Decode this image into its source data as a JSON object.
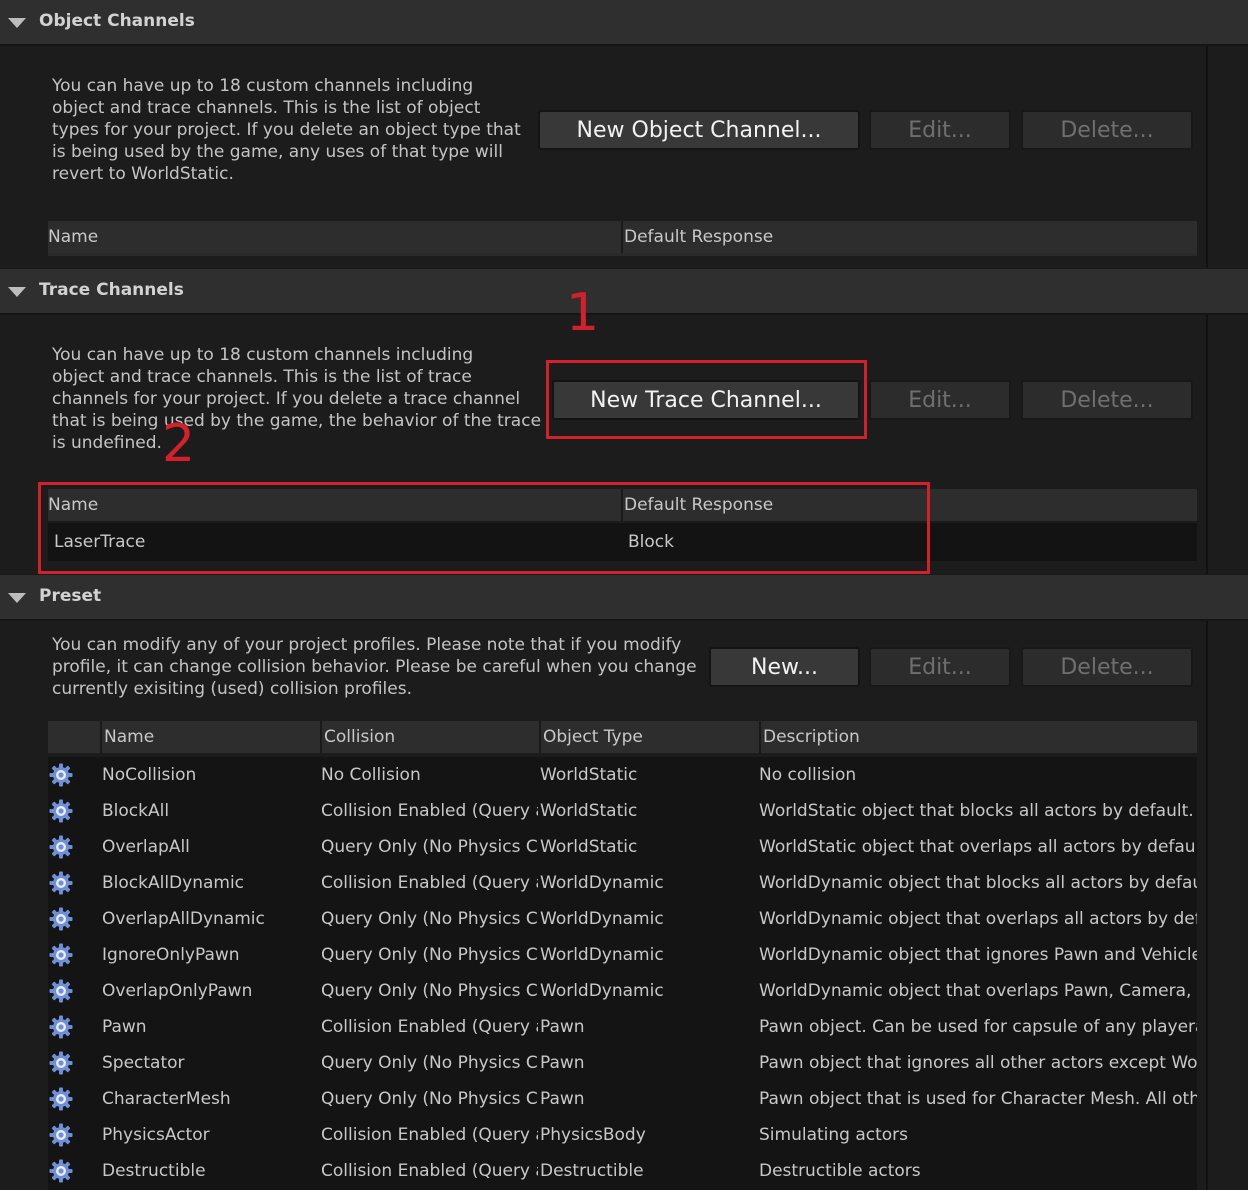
{
  "object_channels": {
    "title": "Object Channels",
    "description": "You can have up to 18 custom channels including\nobject and trace channels. This is the list of object\ntypes for your project. If you delete an object type that\nis being used by the game, any uses of that type will\nrevert to WorldStatic.",
    "new_button": "New Object Channel...",
    "edit_button": "Edit...",
    "delete_button": "Delete...",
    "columns": [
      "Name",
      "Default Response"
    ]
  },
  "trace_channels": {
    "title": "Trace Channels",
    "description": "You can have up to 18 custom channels including\nobject and trace channels. This is the list of trace\nchannels for your project. If you delete a trace channel\nthat is being used by the game, the behavior of the trace\nis undefined.",
    "new_button": "New Trace Channel...",
    "edit_button": "Edit...",
    "delete_button": "Delete...",
    "columns": [
      "Name",
      "Default Response"
    ],
    "rows": [
      {
        "name": "LaserTrace",
        "response": "Block"
      }
    ]
  },
  "annotations": {
    "one": "1",
    "two": "2"
  },
  "preset": {
    "title": "Preset",
    "description": "You can modify any of your project profiles. Please note that if you modify\nprofile, it can change collision behavior. Please be careful when you change\ncurrently exisiting (used) collision profiles.",
    "new_button": "New...",
    "edit_button": "Edit...",
    "delete_button": "Delete...",
    "columns": [
      "Name",
      "Collision",
      "Object Type",
      "Description"
    ],
    "rows": [
      {
        "name": "NoCollision",
        "collision": "No Collision",
        "object_type": "WorldStatic",
        "description": "No collision"
      },
      {
        "name": "BlockAll",
        "collision": "Collision Enabled (Query and Physics)",
        "object_type": "WorldStatic",
        "description": "WorldStatic object that blocks all actors by default."
      },
      {
        "name": "OverlapAll",
        "collision": "Query Only (No Physics Collision)",
        "object_type": "WorldStatic",
        "description": "WorldStatic object that overlaps all actors by default."
      },
      {
        "name": "BlockAllDynamic",
        "collision": "Collision Enabled (Query and Physics)",
        "object_type": "WorldDynamic",
        "description": "WorldDynamic object that blocks all actors by default."
      },
      {
        "name": "OverlapAllDynamic",
        "collision": "Query Only (No Physics Collision)",
        "object_type": "WorldDynamic",
        "description": "WorldDynamic object that overlaps all actors by default."
      },
      {
        "name": "IgnoreOnlyPawn",
        "collision": "Query Only (No Physics Collision)",
        "object_type": "WorldDynamic",
        "description": "WorldDynamic object that ignores Pawn and Vehicle."
      },
      {
        "name": "OverlapOnlyPawn",
        "collision": "Query Only (No Physics Collision)",
        "object_type": "WorldDynamic",
        "description": "WorldDynamic object that overlaps Pawn, Camera, and Vehicle."
      },
      {
        "name": "Pawn",
        "collision": "Collision Enabled (Query and Physics)",
        "object_type": "Pawn",
        "description": "Pawn object. Can be used for capsule of any playerable character or AI."
      },
      {
        "name": "Spectator",
        "collision": "Query Only (No Physics Collision)",
        "object_type": "Pawn",
        "description": "Pawn object that ignores all other actors except WorldStatic."
      },
      {
        "name": "CharacterMesh",
        "collision": "Query Only (No Physics Collision)",
        "object_type": "Pawn",
        "description": "Pawn object that is used for Character Mesh. All other channels will be set to default."
      },
      {
        "name": "PhysicsActor",
        "collision": "Collision Enabled (Query and Physics)",
        "object_type": "PhysicsBody",
        "description": "Simulating actors"
      },
      {
        "name": "Destructible",
        "collision": "Collision Enabled (Query and Physics)",
        "object_type": "Destructible",
        "description": "Destructible actors"
      }
    ]
  }
}
